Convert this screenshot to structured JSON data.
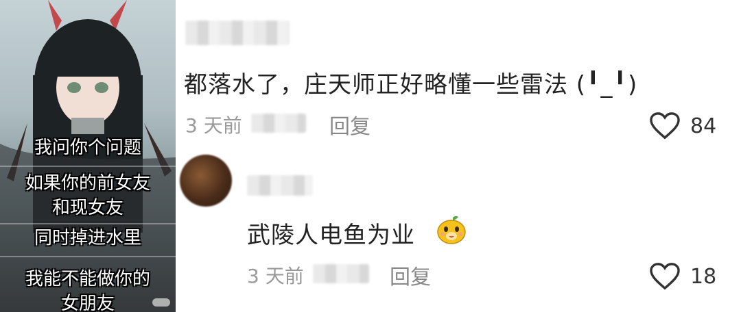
{
  "meme": {
    "captions": [
      "我问你个问题",
      "如果你的前女友\n和现女友",
      "同时掉进水里",
      "我能不能做你的\n女朋友"
    ]
  },
  "comments": [
    {
      "text": "都落水了，庄天师正好略懂一些雷法 (╹_╹)",
      "time": "3 天前",
      "reply_label": "回复",
      "likes": "84"
    },
    {
      "text": "武陵人电鱼为业",
      "emoji_icon": "bear-face-emoji",
      "time": "3 天前",
      "reply_label": "回复",
      "likes": "18"
    }
  ],
  "colors": {
    "text": "#222222",
    "meta": "#999999",
    "accent_emoji": "#f5c21b"
  }
}
